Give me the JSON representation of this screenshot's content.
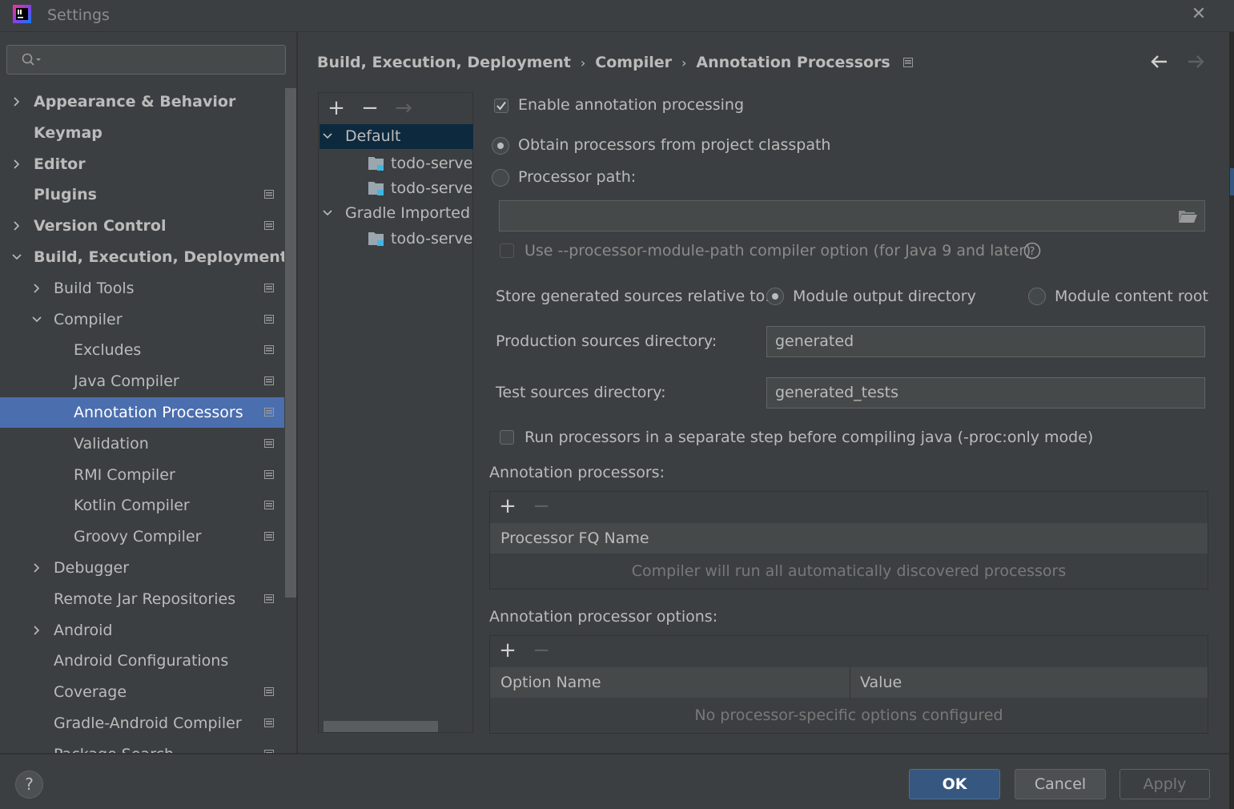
{
  "window": {
    "title": "Settings",
    "close_glyph": "✕"
  },
  "search": {
    "placeholder": "",
    "value": ""
  },
  "nav": {
    "items": [
      {
        "label": "Appearance & Behavior",
        "indent": 0,
        "expandable": true,
        "expanded": false,
        "bold": true,
        "project": false
      },
      {
        "label": "Keymap",
        "indent": 0,
        "expandable": false,
        "bold": true,
        "project": false
      },
      {
        "label": "Editor",
        "indent": 0,
        "expandable": true,
        "expanded": false,
        "bold": true,
        "project": false
      },
      {
        "label": "Plugins",
        "indent": 0,
        "expandable": false,
        "bold": true,
        "project": true
      },
      {
        "label": "Version Control",
        "indent": 0,
        "expandable": true,
        "expanded": false,
        "bold": true,
        "project": true
      },
      {
        "label": "Build, Execution, Deployment",
        "indent": 0,
        "expandable": true,
        "expanded": true,
        "bold": true,
        "project": false
      },
      {
        "label": "Build Tools",
        "indent": 1,
        "expandable": true,
        "expanded": false,
        "bold": false,
        "project": true
      },
      {
        "label": "Compiler",
        "indent": 1,
        "expandable": true,
        "expanded": true,
        "bold": false,
        "project": true
      },
      {
        "label": "Excludes",
        "indent": 2,
        "expandable": false,
        "bold": false,
        "project": true
      },
      {
        "label": "Java Compiler",
        "indent": 2,
        "expandable": false,
        "bold": false,
        "project": true
      },
      {
        "label": "Annotation Processors",
        "indent": 2,
        "expandable": false,
        "bold": false,
        "project": true,
        "selected": true
      },
      {
        "label": "Validation",
        "indent": 2,
        "expandable": false,
        "bold": false,
        "project": true
      },
      {
        "label": "RMI Compiler",
        "indent": 2,
        "expandable": false,
        "bold": false,
        "project": true
      },
      {
        "label": "Kotlin Compiler",
        "indent": 2,
        "expandable": false,
        "bold": false,
        "project": true
      },
      {
        "label": "Groovy Compiler",
        "indent": 2,
        "expandable": false,
        "bold": false,
        "project": true
      },
      {
        "label": "Debugger",
        "indent": 1,
        "expandable": true,
        "expanded": false,
        "bold": false,
        "project": false
      },
      {
        "label": "Remote Jar Repositories",
        "indent": 1,
        "expandable": false,
        "bold": false,
        "project": true
      },
      {
        "label": "Android",
        "indent": 1,
        "expandable": true,
        "expanded": false,
        "bold": false,
        "project": false
      },
      {
        "label": "Android Configurations",
        "indent": 1,
        "expandable": false,
        "bold": false,
        "project": false
      },
      {
        "label": "Coverage",
        "indent": 1,
        "expandable": false,
        "bold": false,
        "project": true
      },
      {
        "label": "Gradle-Android Compiler",
        "indent": 1,
        "expandable": false,
        "bold": false,
        "project": true
      },
      {
        "label": "Package Search",
        "indent": 1,
        "expandable": false,
        "bold": false,
        "project": true
      }
    ]
  },
  "header": {
    "breadcrumbs": [
      "Build, Execution, Deployment",
      "Compiler",
      "Annotation Processors"
    ],
    "separator": "›"
  },
  "profiles": {
    "toolbar": {
      "add": "+",
      "remove": "−",
      "move": "→"
    },
    "tree": [
      {
        "label": "Default",
        "group": true,
        "selected": true
      },
      {
        "label": "todo-server",
        "group": false
      },
      {
        "label": "todo-server",
        "group": false
      },
      {
        "label": "Gradle Imported",
        "group": true,
        "selected": false
      },
      {
        "label": "todo-server",
        "group": false
      }
    ]
  },
  "settings": {
    "enable_processing": {
      "label": "Enable annotation processing",
      "checked": true
    },
    "obtain_classpath": {
      "label": "Obtain processors from project classpath",
      "selected": true
    },
    "processor_path": {
      "label": "Processor path:",
      "selected": false,
      "value": ""
    },
    "module_path_option": {
      "label": "Use --processor-module-path compiler option (for Java 9 and later)",
      "checked": false,
      "enabled": false
    },
    "store_relative": {
      "label": "Store generated sources relative to:",
      "options": [
        "Module output directory",
        "Module content root"
      ],
      "selected": "Module output directory"
    },
    "production_dir": {
      "label": "Production sources directory:",
      "value": "generated"
    },
    "test_dir": {
      "label": "Test sources directory:",
      "value": "generated_tests"
    },
    "proc_only": {
      "label": "Run processors in a separate step before compiling java (-proc:only mode)",
      "checked": false
    },
    "processors_table": {
      "title": "Annotation processors:",
      "columns": [
        "Processor FQ Name"
      ],
      "empty_text": "Compiler will run all automatically discovered processors"
    },
    "options_table": {
      "title": "Annotation processor options:",
      "columns": [
        "Option Name",
        "Value"
      ],
      "empty_text": "No processor-specific options configured"
    },
    "toolbar": {
      "add": "+",
      "remove": "−"
    }
  },
  "buttons": {
    "help": "?",
    "ok": "OK",
    "cancel": "Cancel",
    "apply": "Apply"
  },
  "colors": {
    "background": "#3c3f41",
    "selection": "#4b6eaf",
    "tree_selection": "#0d293e",
    "ok_button": "#365880",
    "text": "#bbbbbb"
  }
}
